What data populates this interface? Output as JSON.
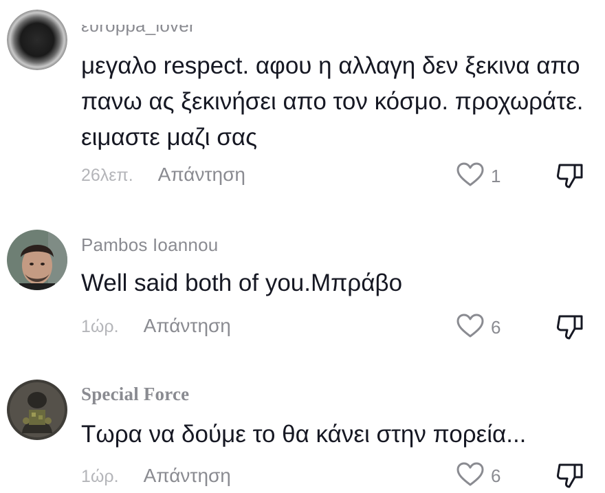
{
  "comments": [
    {
      "username": "ευroppa_lover",
      "text": "μεγαλο respect. αφου η αλλαγη δεν ξεκινα απο πανω ας ξεκινήσει απο τον κόσμο. προχωράτε. ειμαστε μαζι σας",
      "time": "26λεπ.",
      "reply_label": "Απάντηση",
      "likes": "1"
    },
    {
      "username": "Pambos Ioannou",
      "text": "Well said both of you.Μπράβο",
      "time": "1ώρ.",
      "reply_label": "Απάντηση",
      "likes": "6"
    },
    {
      "username": "Special Force",
      "text": "Τωρα να δούμε το θα κάνει στην πορεία...",
      "time": "1ώρ.",
      "reply_label": "Απάντηση",
      "likes": "6"
    }
  ],
  "icons": {
    "like": "heart-outline-icon",
    "dislike": "thumbs-down-icon"
  },
  "colors": {
    "text": "#161823",
    "username": "#8a8b91",
    "time": "#b4b5b9",
    "icon": "#8a8b91"
  }
}
